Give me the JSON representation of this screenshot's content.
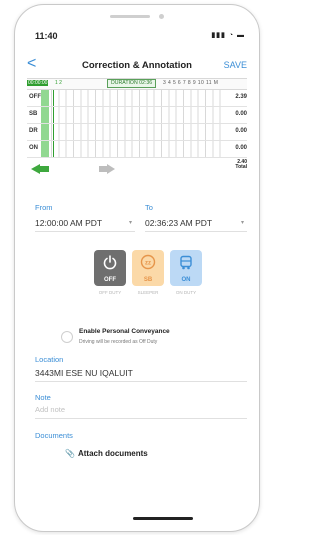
{
  "status_bar": {
    "time": "11:40",
    "icons": "▮▮▮ ◔ ▬"
  },
  "nav": {
    "back": "<",
    "title": "Correction & Annotation",
    "save": "SAVE"
  },
  "log": {
    "start_marker": "00:00:00",
    "hour1": "1 2",
    "duration": "DURATION 02:36",
    "hours_rest": "3 4 5 6 7 8 9 10 11 M",
    "rows": [
      {
        "label": "OFF",
        "value": "2.39"
      },
      {
        "label": "SB",
        "value": "0.00"
      },
      {
        "label": "DR",
        "value": "0.00"
      },
      {
        "label": "ON",
        "value": "0.00"
      }
    ],
    "total_value": "2.40",
    "total_label": "Total"
  },
  "from": {
    "label": "From",
    "value": "12:00:00 AM PDT"
  },
  "to": {
    "label": "To",
    "value": "02:36:23 AM PDT"
  },
  "statuses": [
    {
      "label": "OFF",
      "sub": "OFF DUTY"
    },
    {
      "label": "SB",
      "sub": "SLEEPER"
    },
    {
      "label": "ON",
      "sub": "ON DUTY"
    }
  ],
  "colors": {
    "accent": "#3b8ed6",
    "green": "#2f9e2f",
    "off": "#6f6f6f",
    "sleeper": "#f5a25d",
    "on_duty": "#3b8ed6"
  },
  "personal_conveyance": {
    "title": "Enable Personal Conveyance",
    "subtitle": "Driving will be recorded as Off Duty"
  },
  "location": {
    "label": "Location",
    "value": "3443MI ESE NU IQALUIT"
  },
  "note": {
    "label": "Note",
    "placeholder": "Add note"
  },
  "documents": {
    "label": "Documents",
    "attach": "Attach documents"
  }
}
